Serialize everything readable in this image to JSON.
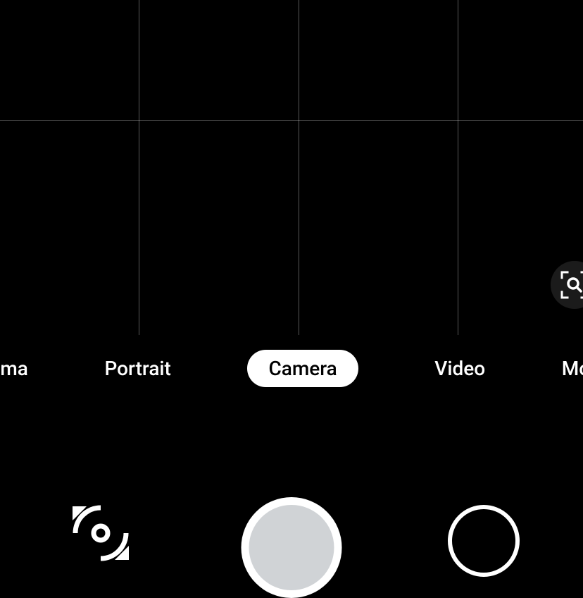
{
  "modes": {
    "panorama": "orama",
    "portrait": "Portrait",
    "camera": "Camera",
    "video": "Video",
    "more": "Mor"
  },
  "active_mode": "camera"
}
